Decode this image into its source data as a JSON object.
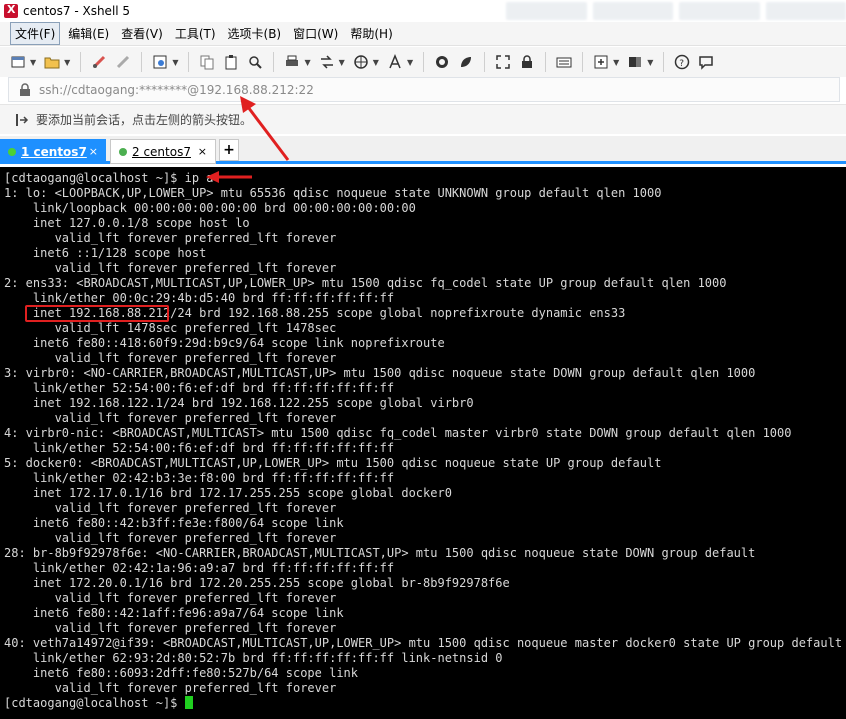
{
  "window": {
    "title": "centos7 - Xshell 5"
  },
  "menu": {
    "items": [
      {
        "label": "文件(F)",
        "active": true
      },
      {
        "label": "编辑(E)",
        "active": false
      },
      {
        "label": "查看(V)",
        "active": false
      },
      {
        "label": "工具(T)",
        "active": false
      },
      {
        "label": "选项卡(B)",
        "active": false
      },
      {
        "label": "窗口(W)",
        "active": false
      },
      {
        "label": "帮助(H)",
        "active": false
      }
    ]
  },
  "address": {
    "text": "ssh://cdtaogang:********@192.168.88.212:22"
  },
  "hint": {
    "text": "要添加当前会话，点击左侧的箭头按钮。"
  },
  "tabs": [
    {
      "label": "1 centos7",
      "close": "×",
      "active": true
    },
    {
      "label": "2 centos7",
      "close": "×",
      "active": false
    }
  ],
  "tab_add": "+",
  "terminal": {
    "lines": [
      "[cdtaogang@localhost ~]$ ip a",
      "1: lo: <LOOPBACK,UP,LOWER_UP> mtu 65536 qdisc noqueue state UNKNOWN group default qlen 1000",
      "    link/loopback 00:00:00:00:00:00 brd 00:00:00:00:00:00",
      "    inet 127.0.0.1/8 scope host lo",
      "       valid_lft forever preferred_lft forever",
      "    inet6 ::1/128 scope host",
      "       valid_lft forever preferred_lft forever",
      "2: ens33: <BROADCAST,MULTICAST,UP,LOWER_UP> mtu 1500 qdisc fq_codel state UP group default qlen 1000",
      "    link/ether 00:0c:29:4b:d5:40 brd ff:ff:ff:ff:ff:ff",
      "    inet 192.168.88.212/24 brd 192.168.88.255 scope global noprefixroute dynamic ens33",
      "       valid_lft 1478sec preferred_lft 1478sec",
      "    inet6 fe80::418:60f9:29d:b9c9/64 scope link noprefixroute",
      "       valid_lft forever preferred_lft forever",
      "3: virbr0: <NO-CARRIER,BROADCAST,MULTICAST,UP> mtu 1500 qdisc noqueue state DOWN group default qlen 1000",
      "    link/ether 52:54:00:f6:ef:df brd ff:ff:ff:ff:ff:ff",
      "    inet 192.168.122.1/24 brd 192.168.122.255 scope global virbr0",
      "       valid_lft forever preferred_lft forever",
      "4: virbr0-nic: <BROADCAST,MULTICAST> mtu 1500 qdisc fq_codel master virbr0 state DOWN group default qlen 1000",
      "    link/ether 52:54:00:f6:ef:df brd ff:ff:ff:ff:ff:ff",
      "5: docker0: <BROADCAST,MULTICAST,UP,LOWER_UP> mtu 1500 qdisc noqueue state UP group default",
      "    link/ether 02:42:b3:3e:f8:00 brd ff:ff:ff:ff:ff:ff",
      "    inet 172.17.0.1/16 brd 172.17.255.255 scope global docker0",
      "       valid_lft forever preferred_lft forever",
      "    inet6 fe80::42:b3ff:fe3e:f800/64 scope link",
      "       valid_lft forever preferred_lft forever",
      "28: br-8b9f92978f6e: <NO-CARRIER,BROADCAST,MULTICAST,UP> mtu 1500 qdisc noqueue state DOWN group default",
      "    link/ether 02:42:1a:96:a9:a7 brd ff:ff:ff:ff:ff:ff",
      "    inet 172.20.0.1/16 brd 172.20.255.255 scope global br-8b9f92978f6e",
      "       valid_lft forever preferred_lft forever",
      "    inet6 fe80::42:1aff:fe96:a9a7/64 scope link",
      "       valid_lft forever preferred_lft forever",
      "40: veth7a14972@if39: <BROADCAST,MULTICAST,UP,LOWER_UP> mtu 1500 qdisc noqueue master docker0 state UP group default",
      "    link/ether 62:93:2d:80:52:7b brd ff:ff:ff:ff:ff:ff link-netnsid 0",
      "    inet6 fe80::6093:2dff:fe80:527b/64 scope link",
      "       valid_lft forever preferred_lft forever",
      "[cdtaogang@localhost ~]$ "
    ]
  },
  "colors": {
    "tab_active": "#1e90ff",
    "terminal_bg": "#000000",
    "terminal_fg": "#d8d8d8",
    "cursor": "#20d020",
    "annotation": "#e02020"
  },
  "toolbar_icons": [
    "new-session-icon",
    "open-folder-icon",
    "disconnect-icon",
    "reconnect-icon",
    "properties-icon",
    "copy-icon",
    "paste-icon",
    "find-icon",
    "print-icon",
    "transfer-icon",
    "globe-icon",
    "font-icon",
    "xftp-icon",
    "xmanager-icon",
    "fullscreen-icon",
    "lock-icon",
    "keyboard-icon",
    "add-icon",
    "layout-icon",
    "help-icon",
    "chat-icon"
  ]
}
